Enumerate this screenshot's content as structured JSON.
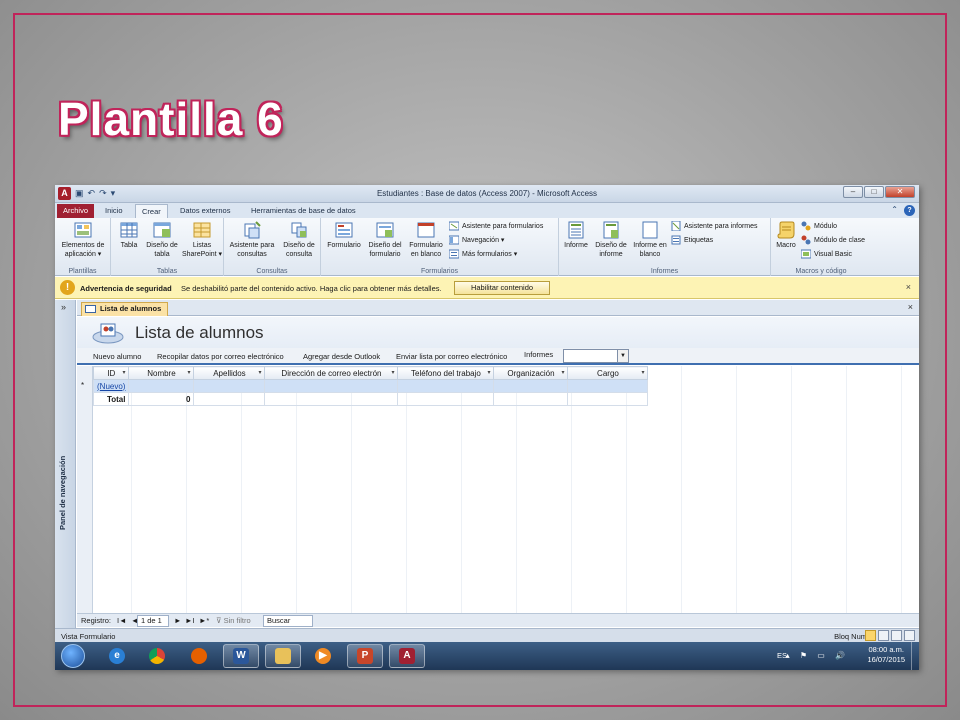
{
  "slide": {
    "title": "Plantilla 6"
  },
  "window": {
    "title": "Estudiantes : Base de datos (Access 2007) - Microsoft Access",
    "controls": [
      "–",
      "□",
      "✕"
    ]
  },
  "tabs": [
    "Archivo",
    "Inicio",
    "Crear",
    "Datos externos",
    "Herramientas de base de datos"
  ],
  "ribbon": {
    "groups": {
      "plantillas": {
        "label": "Plantillas",
        "btn1": "Elementos de aplicación ▾"
      },
      "tablas": {
        "label": "Tablas",
        "btn1": "Tabla",
        "btn2": "Diseño de tabla",
        "btn3": "Listas SharePoint ▾"
      },
      "consultas": {
        "label": "Consultas",
        "btn1": "Asistente para consultas",
        "btn2": "Diseño de consulta"
      },
      "formularios": {
        "label": "Formularios",
        "btn1": "Formulario",
        "btn2": "Diseño del formulario",
        "btn3": "Formulario en blanco",
        "s1": "Asistente para formularios",
        "s2": "Navegación ▾",
        "s3": "Más formularios ▾"
      },
      "informes": {
        "label": "Informes",
        "btn1": "Informe",
        "btn2": "Diseño de informe",
        "btn3": "Informe en blanco",
        "s1": "Asistente para informes",
        "s2": "Etiquetas"
      },
      "macros": {
        "label": "Macros y código",
        "btn1": "Macro",
        "s1": "Módulo",
        "s2": "Módulo de clase",
        "s3": "Visual Basic"
      }
    }
  },
  "security": {
    "heading": "Advertencia de seguridad",
    "message": "Se deshabilitó parte del contenido activo. Haga clic para obtener más detalles.",
    "button": "Habilitar contenido",
    "close": "×"
  },
  "nav": {
    "chevron": "»",
    "label": "Panel de navegación"
  },
  "doc": {
    "tab": "Lista de alumnos",
    "close": "×"
  },
  "form": {
    "title": "Lista de alumnos",
    "commands": [
      "Nuevo alumno",
      "Recopilar datos por correo electrónico",
      "Agregar desde Outlook",
      "Enviar lista por correo electrónico",
      "Informes"
    ],
    "combo_value": ""
  },
  "grid": {
    "columns": [
      "ID",
      "Nombre",
      "Apellidos",
      "Dirección de correo electrón",
      "Teléfono del trabajo",
      "Organización",
      "Cargo"
    ],
    "new_row": {
      "marker": "*",
      "id": "(Nuevo)"
    },
    "total_row": {
      "label": "Total",
      "nombre": "0"
    }
  },
  "recnav": {
    "label": "Registro:",
    "first": "I◄",
    "prev": "◄",
    "position": "1 de 1",
    "next": "►",
    "last": "►I",
    "new": "►*",
    "filter": "Sin filtro",
    "search": "Buscar"
  },
  "status": {
    "left": "Vista Formulario",
    "right": "Bloq Num"
  },
  "taskbar": {
    "lang": "ES",
    "time": "08:00 a.m.",
    "date": "16/07/2015",
    "tray_icons": "▴ ⚑ ▭ 🔊"
  },
  "colors": {
    "accent_frame": "#c0245a",
    "access_red": "#a02032",
    "security_bar": "#fdf3b4"
  }
}
